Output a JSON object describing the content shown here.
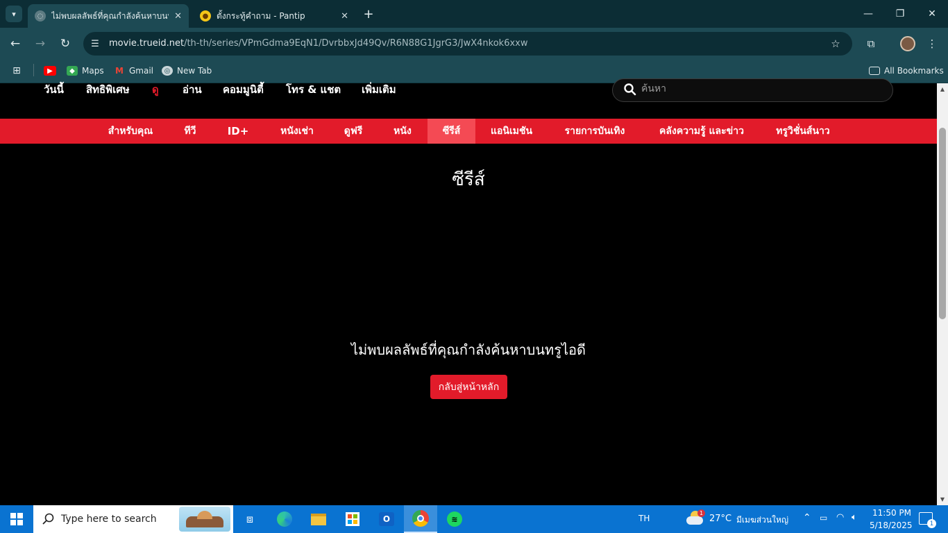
{
  "browser": {
    "tabs": [
      {
        "title": "ไม่พบผลลัพธ์ที่คุณกำลังค้นหาบนทรูไอดี",
        "active": true
      },
      {
        "title": "ตั้งกระทู้คำถาม - Pantip",
        "active": false
      }
    ],
    "url_host": "movie.trueid.net",
    "url_path": "/th-th/series/VPmGdma9EqN1/DvrbbxJd49Qv/R6N88G1JgrG3/JwX4nkok6xxw",
    "bookmarks": [
      "Maps",
      "Gmail",
      "New Tab"
    ],
    "all_bookmarks": "All Bookmarks"
  },
  "site": {
    "top_nav": [
      "วันนี้",
      "สิทธิพิเศษ",
      "ดู",
      "อ่าน",
      "คอมมูนิตี้",
      "โทร & แชต",
      "เพิ่มเติม"
    ],
    "search_placeholder": "ค้นหา",
    "red_nav": [
      "สำหรับคุณ",
      "ทีวี",
      "ID+",
      "หนังเช่า",
      "ดูฟรี",
      "หนัง",
      "ซีรีส์",
      "แอนิเมชัน",
      "รายการบันเทิง",
      "คลังความรู้ และข่าว",
      "ทรูวิชั่นส์นาว"
    ],
    "red_nav_active": "ซีรีส์",
    "page_title": "ซีรีส์",
    "message": "ไม่พบผลลัพธ์ที่คุณกำลังค้นหาบนทรูไอดี",
    "home_button": "กลับสู่หน้าหลัก"
  },
  "taskbar": {
    "search_text": "Type here to search",
    "language": "TH",
    "weather_temp": "27°C",
    "weather_text": "มีเมฆส่วนใหญ่",
    "weather_badge": "1",
    "time": "11:50 PM",
    "date": "5/18/2025",
    "notification_count": "1"
  },
  "colors": {
    "brand_red": "#e21b2a",
    "active_red": "#f44a54",
    "chrome_dark": "#0c2d35",
    "chrome_toolbar": "#1d4a54",
    "taskbar_blue": "#0a73d1"
  }
}
